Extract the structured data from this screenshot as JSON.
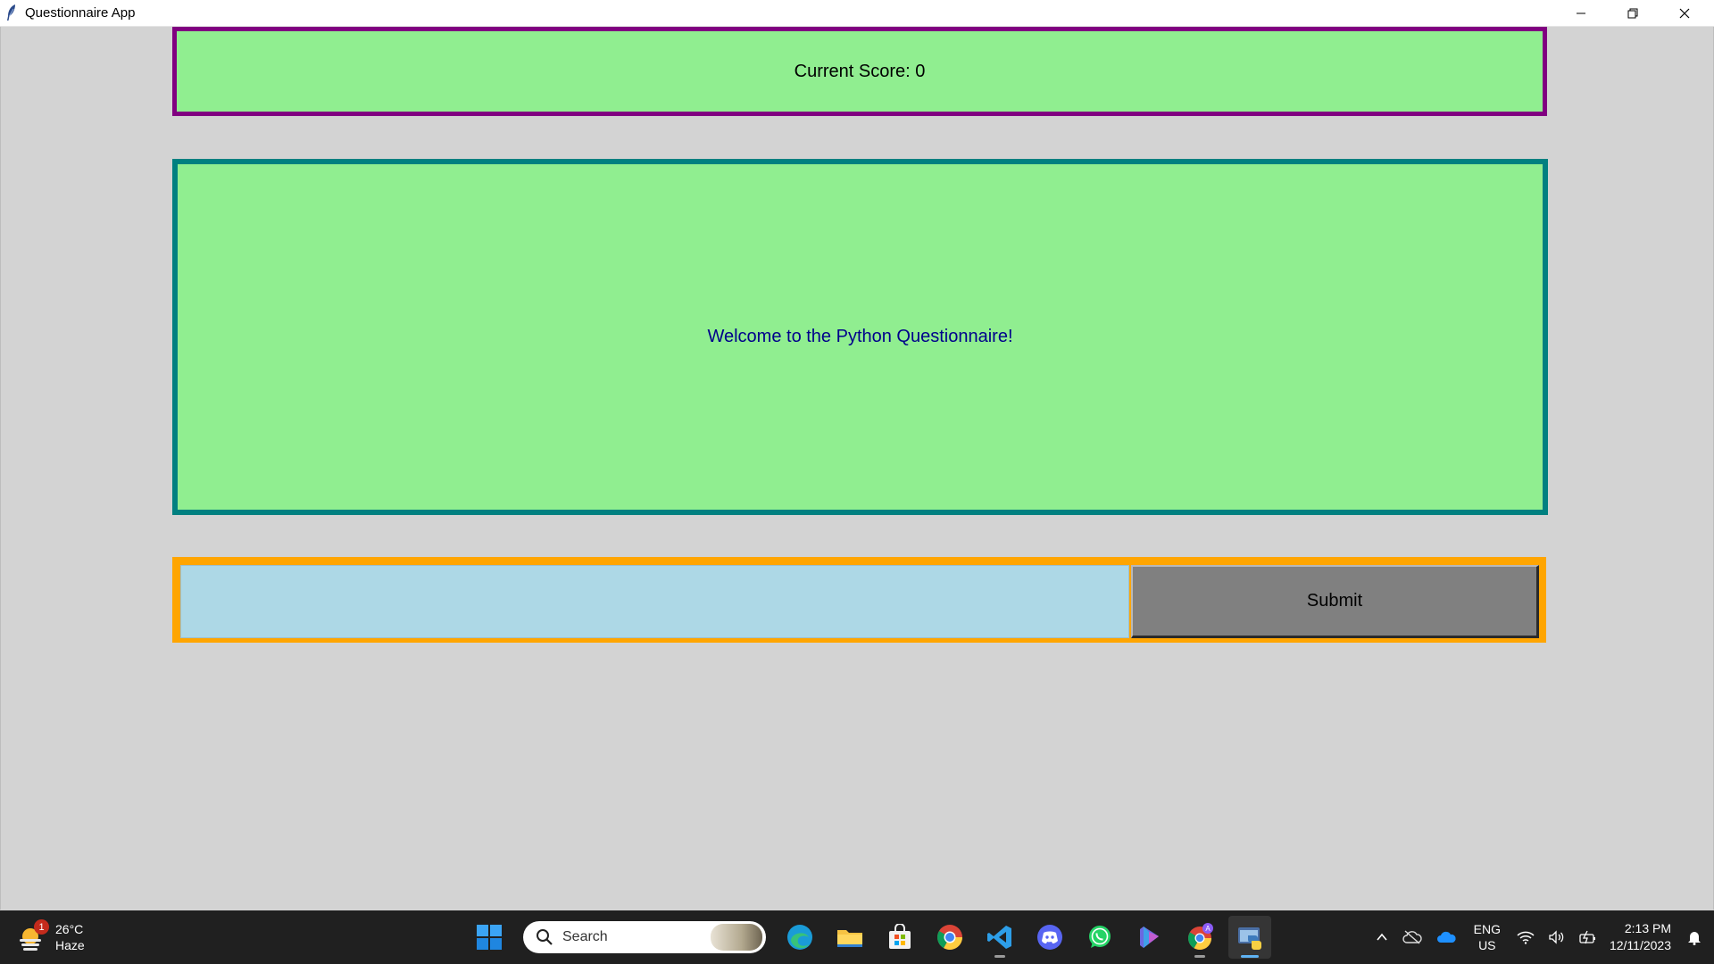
{
  "window": {
    "title": "Questionnaire App",
    "controls": {
      "minimize": "minimize-icon",
      "restore": "restore-icon",
      "close": "close-icon"
    }
  },
  "score": {
    "label": "Current Score: 0"
  },
  "question": {
    "text": "Welcome to the Python Questionnaire!"
  },
  "answer": {
    "value": "",
    "submit_label": "Submit"
  },
  "colors": {
    "background": "#d3d3d3",
    "panel": "#90ee90",
    "score_border": "#800080",
    "question_border": "#008080",
    "answer_frame": "#ffa500",
    "input_bg": "#add8e6",
    "button_bg": "#808080",
    "question_text": "#00008b"
  },
  "taskbar": {
    "weather": {
      "badge": "1",
      "temp": "26°C",
      "condition": "Haze"
    },
    "search": {
      "placeholder": "Search"
    },
    "apps": [
      "windows-start-icon",
      "edge-icon",
      "file-explorer-icon",
      "microsoft-store-icon",
      "chrome-icon",
      "vscode-icon",
      "discord-icon",
      "whatsapp-icon",
      "copilot-icon",
      "chrome-profile-icon",
      "python-app-icon"
    ],
    "tray": {
      "lang_top": "ENG",
      "lang_bottom": "US",
      "time": "2:13 PM",
      "date": "12/11/2023"
    }
  }
}
